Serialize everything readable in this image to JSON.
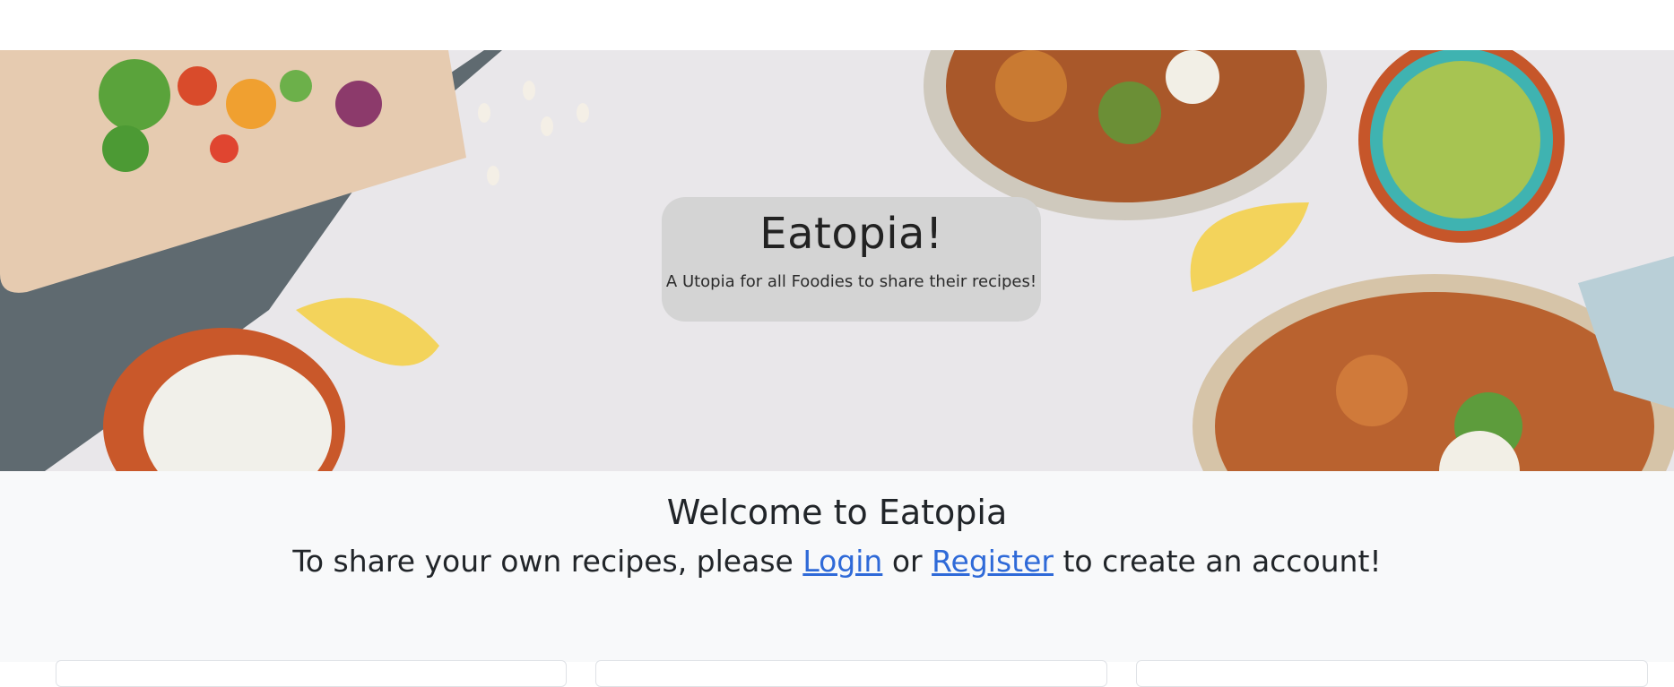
{
  "hero": {
    "title": "Eatopia!",
    "subtitle": "A Utopia for all Foodies to share their recipes!"
  },
  "welcome": {
    "title": "Welcome to Eatopia",
    "text_before": "To share your own recipes, please ",
    "login_label": "Login",
    "text_middle": " or ",
    "register_label": "Register",
    "text_after": " to create an account!"
  },
  "colors": {
    "link": "#2f6ad8",
    "page_background": "#f8f9fa",
    "hero_card": "#d4d4d4"
  }
}
